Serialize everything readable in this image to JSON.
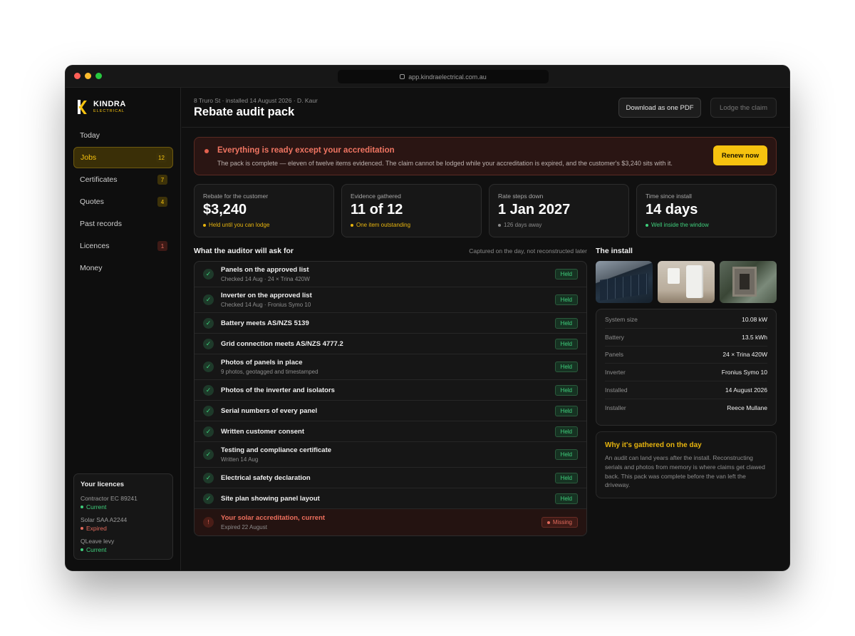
{
  "browser": {
    "url": "app.kindraelectrical.com.au"
  },
  "brand": {
    "name": "KINDRA",
    "sub": "ELECTRICAL",
    "accent": "#f6c20f"
  },
  "nav": [
    {
      "label": "Today",
      "badge": ""
    },
    {
      "label": "Jobs",
      "badge": "12"
    },
    {
      "label": "Certificates",
      "badge": "7"
    },
    {
      "label": "Quotes",
      "badge": "4"
    },
    {
      "label": "Past records",
      "badge": ""
    },
    {
      "label": "Licences",
      "badge": "1"
    },
    {
      "label": "Money",
      "badge": ""
    }
  ],
  "licences": {
    "title": "Your licences",
    "items": [
      {
        "name": "Contractor EC 89241",
        "status": "Current"
      },
      {
        "name": "Solar SAA A2244",
        "status": "Expired"
      },
      {
        "name": "QLeave levy",
        "status": "Current"
      }
    ]
  },
  "header": {
    "breadcrumb": "8 Truro St · installed 14 August 2026 · D. Kaur",
    "title": "Rebate audit pack",
    "pdf_button": "Download as one PDF",
    "lodge_button": "Lodge the claim"
  },
  "alert": {
    "heading": "Everything is ready except your accreditation",
    "body": "The pack is complete — eleven of twelve items evidenced. The claim cannot be lodged while your accreditation is expired, and the customer's $3,240 sits with it.",
    "button": "Renew now"
  },
  "stats": [
    {
      "label": "Rebate for the customer",
      "value": "$3,240",
      "note": "Held until you can lodge"
    },
    {
      "label": "Evidence gathered",
      "value": "11 of 12",
      "note": "One item outstanding"
    },
    {
      "label": "Rate steps down",
      "value": "1 Jan 2027",
      "note": "126 days away"
    },
    {
      "label": "Time since install",
      "value": "14 days",
      "note": "Well inside the window"
    }
  ],
  "checklist": {
    "title": "What the auditor will ask for",
    "note": "Captured on the day, not reconstructed later",
    "held_label": "Held",
    "items": [
      {
        "label": "Panels on the approved list",
        "sub": "Checked 14 Aug · 24 × Trina 420W"
      },
      {
        "label": "Inverter on the approved list",
        "sub": "Checked 14 Aug · Fronius Symo 10"
      },
      {
        "label": "Battery meets AS/NZS 5139",
        "sub": ""
      },
      {
        "label": "Grid connection meets AS/NZS 4777.2",
        "sub": ""
      },
      {
        "label": "Photos of panels in place",
        "sub": "9 photos, geotagged and timestamped"
      },
      {
        "label": "Photos of the inverter and isolators",
        "sub": ""
      },
      {
        "label": "Serial numbers of every panel",
        "sub": ""
      },
      {
        "label": "Written customer consent",
        "sub": ""
      },
      {
        "label": "Testing and compliance certificate",
        "sub": "Written 14 Aug"
      },
      {
        "label": "Electrical safety declaration",
        "sub": ""
      },
      {
        "label": "Site plan showing panel layout",
        "sub": ""
      }
    ],
    "missing": {
      "label": "Your solar accreditation, current",
      "sub": "Expired 22 August",
      "badge": "Missing",
      "icon": "!"
    }
  },
  "install": {
    "title": "The install",
    "specs": [
      {
        "k": "System size",
        "v": "10.08 kW"
      },
      {
        "k": "Battery",
        "v": "13.5 kWh"
      },
      {
        "k": "Panels",
        "v": "24 × Trina 420W"
      },
      {
        "k": "Inverter",
        "v": "Fronius Symo 10"
      },
      {
        "k": "Installed",
        "v": "14 August 2026"
      },
      {
        "k": "Installer",
        "v": "Reece Mullane"
      }
    ]
  },
  "why": {
    "title": "Why it's gathered on the day",
    "body": "An audit can land years after the install. Reconstructing serials and photos from memory is where claims get clawed back. This pack was complete before the van left the driveway."
  }
}
